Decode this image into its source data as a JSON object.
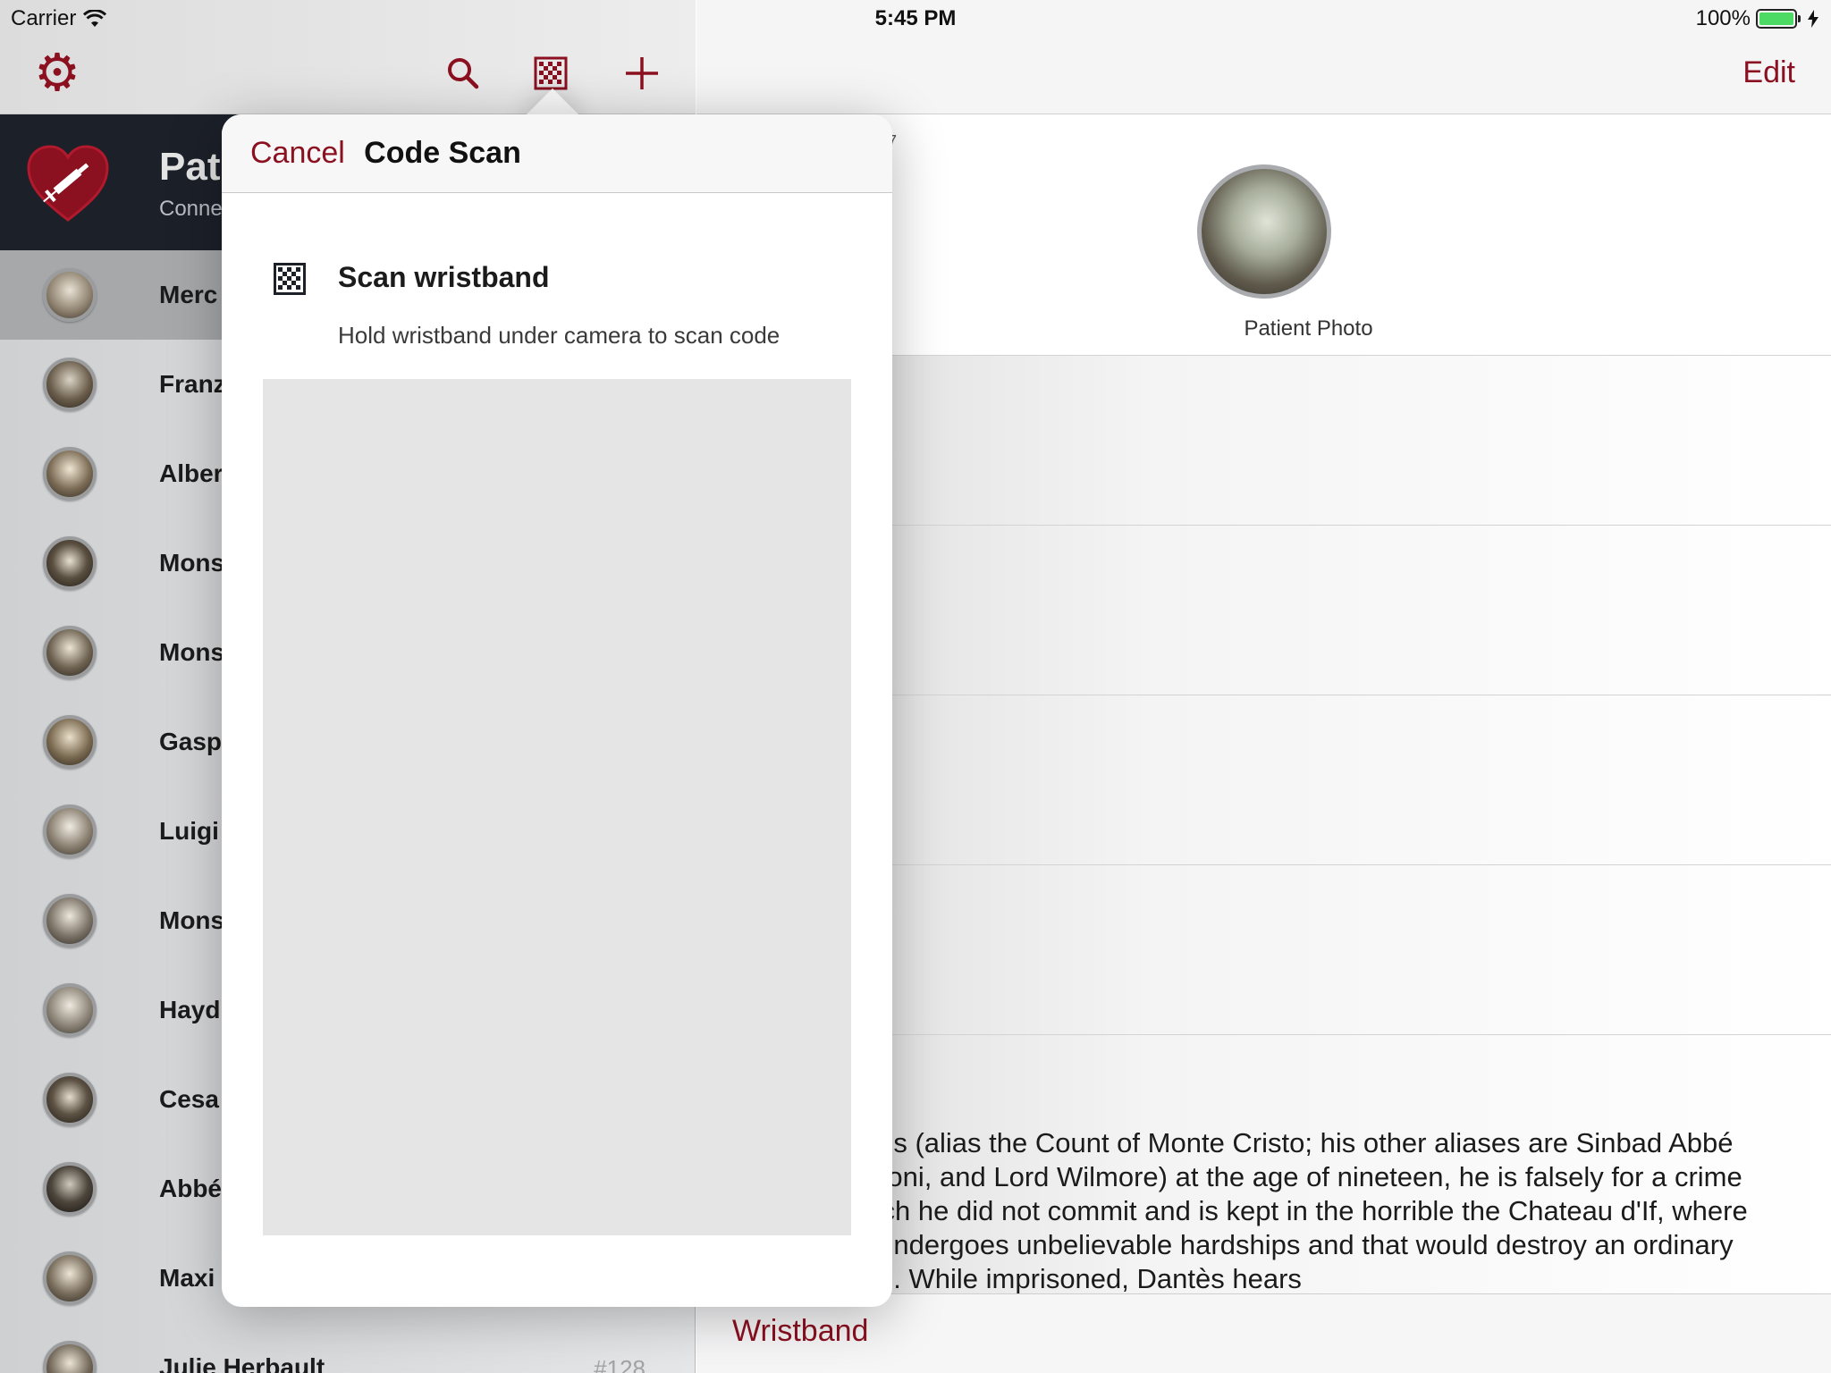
{
  "status_bar": {
    "carrier": "Carrier",
    "time": "5:45 PM",
    "battery": "100%"
  },
  "brand": {
    "title": "Pat",
    "subtitle": "Conne"
  },
  "patients": [
    {
      "name": "Merc",
      "number": ""
    },
    {
      "name": "Franz",
      "number": ""
    },
    {
      "name": "Alber",
      "number": ""
    },
    {
      "name": "Mons",
      "number": ""
    },
    {
      "name": "Mons",
      "number": ""
    },
    {
      "name": "Gasp",
      "number": ""
    },
    {
      "name": "Luigi",
      "number": ""
    },
    {
      "name": "Mons",
      "number": ""
    },
    {
      "name": "Hayd",
      "number": ""
    },
    {
      "name": "Cesa",
      "number": ""
    },
    {
      "name": "Abbé",
      "number": ""
    },
    {
      "name": "Maxi",
      "number": ""
    },
    {
      "name": "Julie Herbault",
      "number": "#128"
    }
  ],
  "detail": {
    "edit_label": "Edit",
    "stub_text": "7",
    "photo_label": "Patient Photo",
    "bio": "antès (alias the Count of Monte Cristo; his other aliases are Sinbad Abbé Busoni, and Lord Wilmore) at the age of nineteen, he is falsely for a crime which he did not commit and is kept in the horrible the Chateau d'If, where he undergoes unbelievable hardships and that would destroy an ordinary man. While imprisoned, Dantès hears",
    "tab_label": "Wristband"
  },
  "popover": {
    "cancel_label": "Cancel",
    "title": "Code Scan",
    "heading": "Scan wristband",
    "hint": "Hold wristband under camera to scan code"
  },
  "colors": {
    "accent": "#8b1020",
    "brand_bg": "#1c2029",
    "battery": "#4cd964"
  },
  "icons": [
    "settings-gear-icon",
    "search-icon",
    "qr-code-icon",
    "add-icon",
    "heart-syringe-logo",
    "wifi-icon",
    "battery-icon",
    "charging-icon"
  ]
}
